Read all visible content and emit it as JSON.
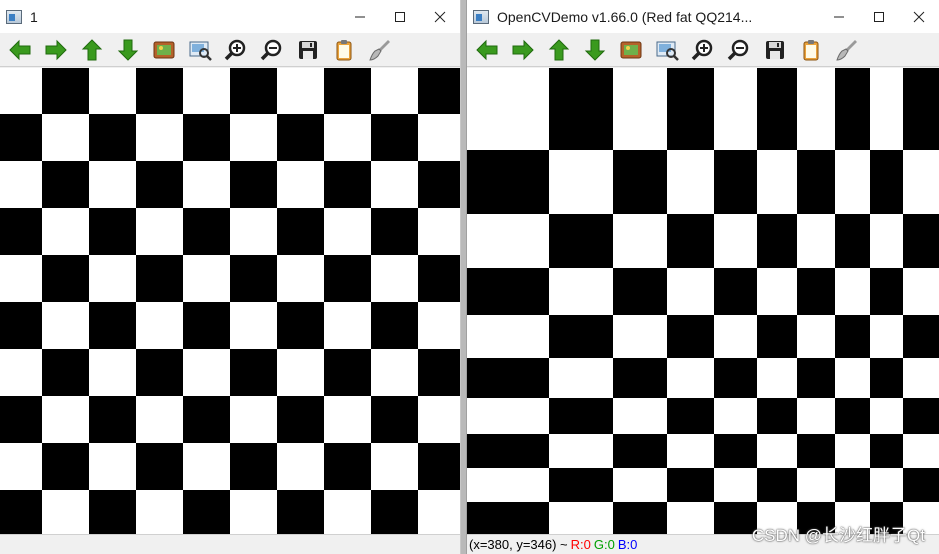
{
  "windows": [
    {
      "title": "1"
    },
    {
      "title": "OpenCVDemo v1.66.0 (Red fat QQ214..."
    }
  ],
  "toolbar_icons": [
    "pan-left-icon",
    "pan-right-icon",
    "pan-up-icon",
    "pan-down-icon",
    "zoom-image-icon",
    "zoom-fit-icon",
    "zoom-in-icon",
    "zoom-out-icon",
    "save-icon",
    "copy-to-clipboard-icon",
    "properties-brush-icon"
  ],
  "status": {
    "coords": "(x=380, y=346) ~",
    "r": "R:0",
    "g": "G:0",
    "b": "B:0"
  },
  "watermark": "CSDN @长沙红胖子Qt",
  "colors": {
    "arrow_green": "#3a9a1e",
    "status_r": "#ff0000",
    "status_g": "#00a000",
    "status_b": "#0000ff"
  }
}
